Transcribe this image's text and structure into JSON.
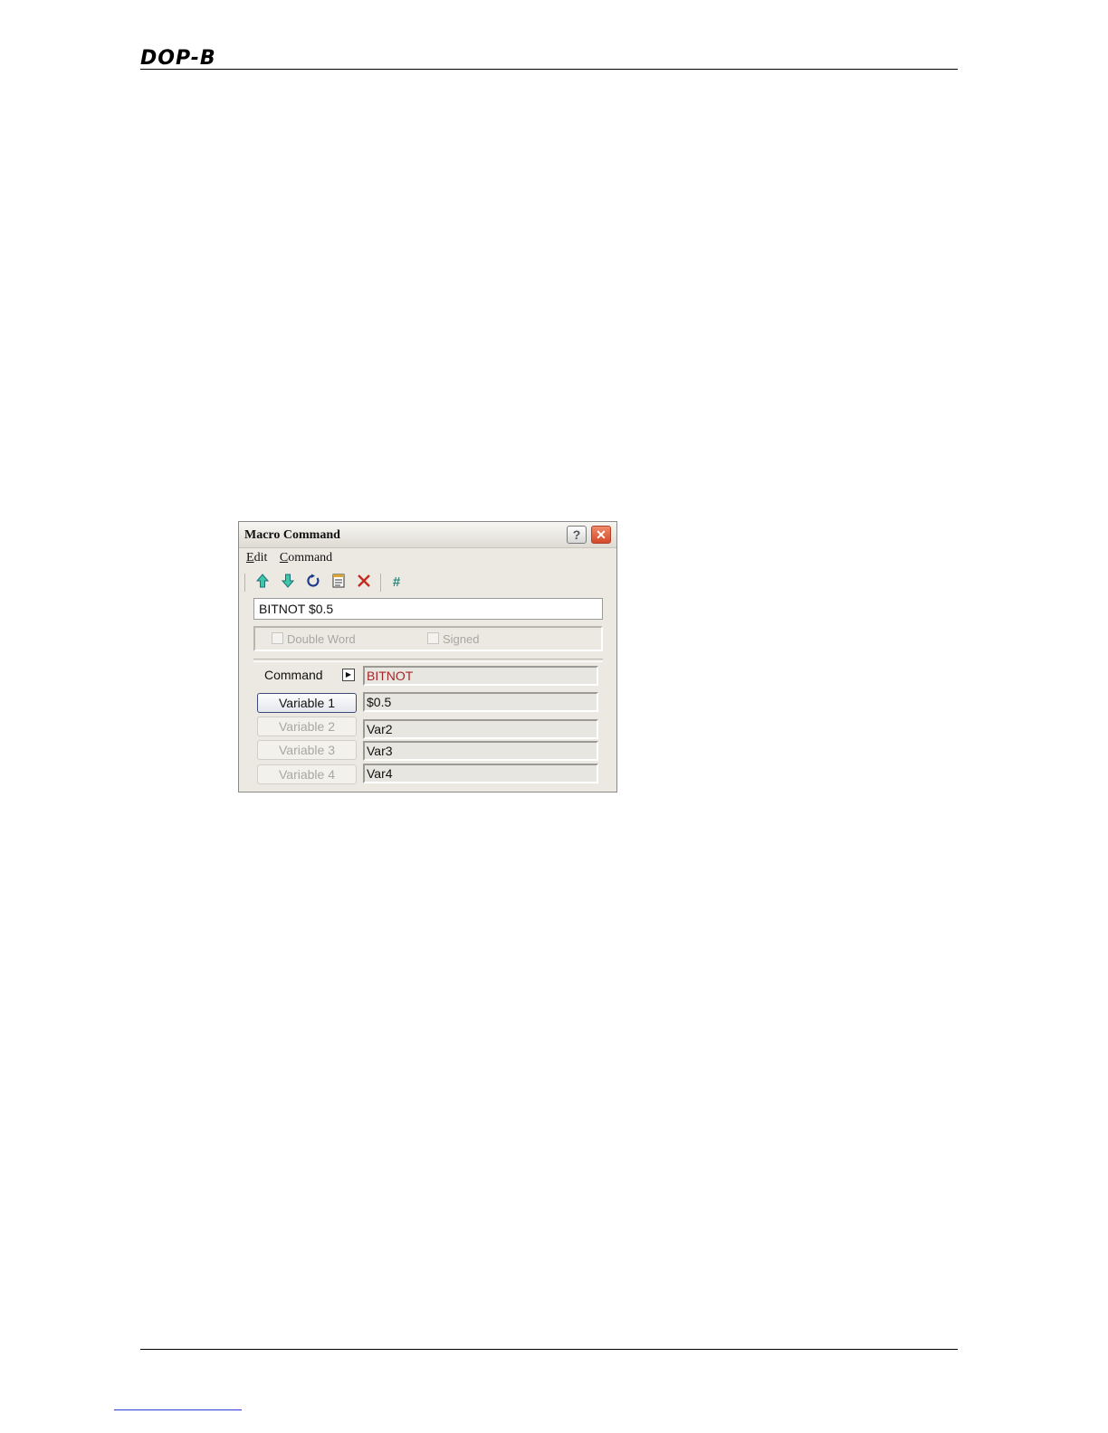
{
  "header": {
    "logo_text": "DOP-B"
  },
  "dialog": {
    "title": "Macro Command",
    "title_buttons": {
      "help": "?",
      "close": "✕"
    },
    "menu": [
      "Edit",
      "Command"
    ],
    "toolbar_icons": [
      "move-up-icon",
      "move-down-icon",
      "refresh-icon",
      "notepad-icon",
      "delete-icon",
      "hash-icon"
    ],
    "command_line": "BITNOT $0.5",
    "options": {
      "double_word": "Double Word",
      "signed": "Signed"
    },
    "command_label": "Command",
    "command_value": "BITNOT",
    "variables": [
      {
        "label": "Variable 1",
        "value": "$0.5",
        "enabled": true
      },
      {
        "label": "Variable 2",
        "value": "Var2",
        "enabled": false
      },
      {
        "label": "Variable 3",
        "value": "Var3",
        "enabled": false
      },
      {
        "label": "Variable 4",
        "value": "Var4",
        "enabled": false
      }
    ],
    "colors": {
      "command_value": "#a3262a",
      "close_button": "#d24a2a"
    }
  }
}
